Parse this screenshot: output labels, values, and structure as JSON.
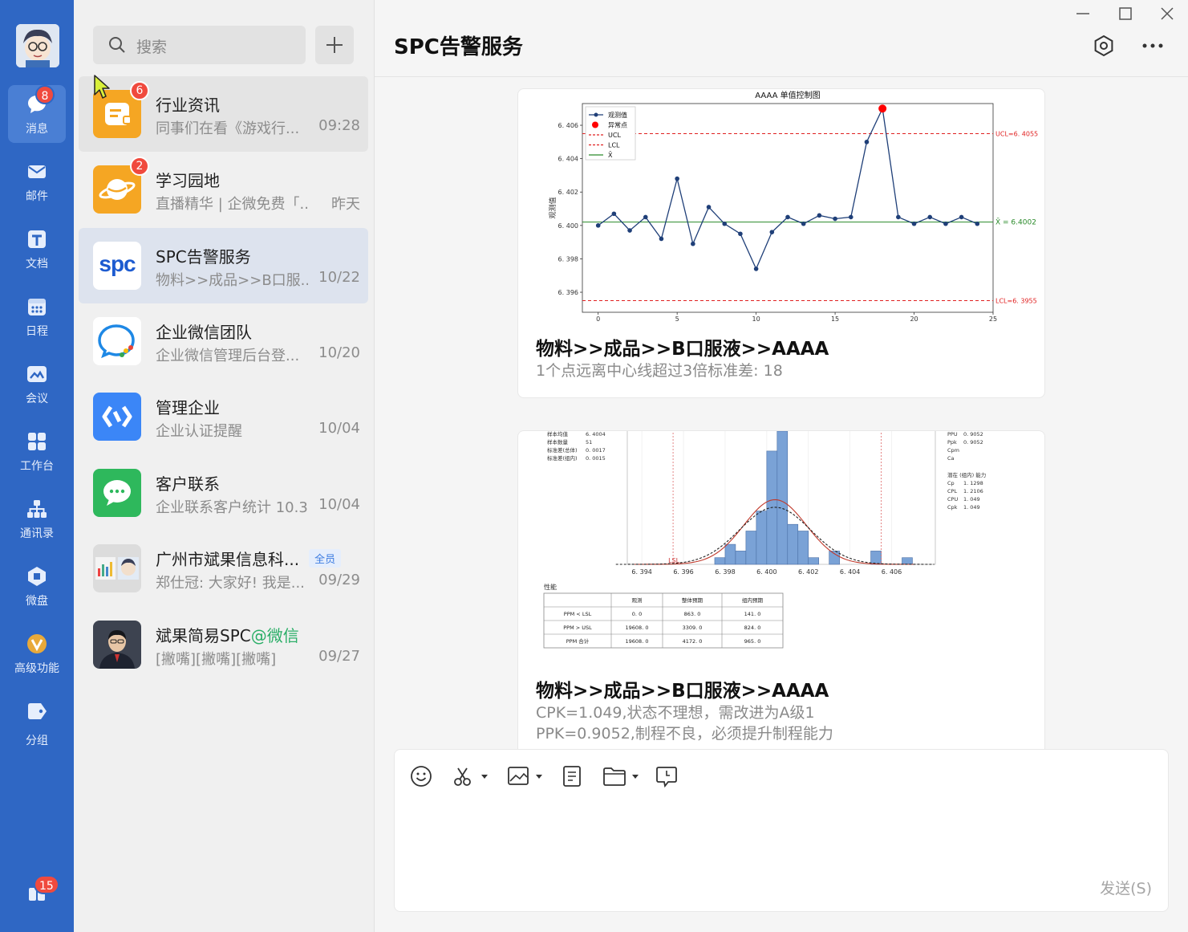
{
  "nav": {
    "items": [
      {
        "label": "消息",
        "badge": "8"
      },
      {
        "label": "邮件"
      },
      {
        "label": "文档"
      },
      {
        "label": "日程"
      },
      {
        "label": "会议"
      },
      {
        "label": "工作台"
      },
      {
        "label": "通讯录"
      },
      {
        "label": "微盘"
      },
      {
        "label": "高级功能"
      },
      {
        "label": "分组"
      }
    ],
    "bottom_badge": "15"
  },
  "search": {
    "placeholder": "搜索"
  },
  "conversations": [
    {
      "name": "行业资讯",
      "preview": "同事们在看《游戏行...",
      "time": "09:28",
      "badge": "6"
    },
    {
      "name": "学习园地",
      "preview": "直播精华 | 企微免费「...",
      "time": "昨天",
      "badge": "2"
    },
    {
      "name": "SPC告警服务",
      "preview": "物料>>成品>>B口服...",
      "time": "10/22",
      "avatar_text": "spc"
    },
    {
      "name": "企业微信团队",
      "preview": "企业微信管理后台登...",
      "time": "10/20"
    },
    {
      "name": "管理企业",
      "preview": "企业认证提醒",
      "time": "10/04"
    },
    {
      "name": "客户联系",
      "preview": "企业联系客户统计 10.3",
      "time": "10/04"
    },
    {
      "name": "广州市斌果信息科...",
      "tag": "全员",
      "preview": "郑仕冠: 大家好! 我是...",
      "time": "09/29"
    },
    {
      "name": "斌果简易SPC",
      "at": "@微信",
      "preview": "[撇嘴][撇嘴][撇嘴]",
      "time": "09/27"
    }
  ],
  "chat": {
    "title": "SPC告警服务",
    "messages": [
      {
        "title": "物料>>成品>>B口服液>>AAAA",
        "desc": "1个点远离中心线超过3倍标准差: 18"
      },
      {
        "title": "物料>>成品>>B口服液>>AAAA",
        "desc1": "CPK=1.049,状态不理想，需改进为A级1",
        "desc2": "PPK=0.9052,制程不良，必须提升制程能力"
      }
    ],
    "send_label": "发送(S)"
  },
  "chart_data": [
    {
      "type": "line",
      "title": "AAAA  单值控制图",
      "ylabel": "观测值",
      "xlim": [
        -1,
        25
      ],
      "ylim": [
        6.3948,
        6.4073
      ],
      "xticks": [
        0,
        5,
        10,
        15,
        20,
        25
      ],
      "yticks": [
        6.396,
        6.398,
        6.4,
        6.402,
        6.404,
        6.406
      ],
      "ytick_labels": [
        "6. 396",
        "6. 398",
        "6. 400",
        "6. 402",
        "6. 404",
        "6. 406"
      ],
      "legend": [
        "观测值",
        "异常点",
        "UCL",
        "LCL",
        "X̄"
      ],
      "legend_position": "top-left",
      "series": [
        {
          "name": "观测值",
          "color": "#1f3f78",
          "x": [
            0,
            1,
            2,
            3,
            4,
            5,
            6,
            7,
            8,
            9,
            10,
            11,
            12,
            13,
            14,
            15,
            16,
            17,
            18,
            19,
            20,
            21,
            22,
            23,
            24
          ],
          "values": [
            6.4,
            6.4007,
            6.3997,
            6.4005,
            6.3992,
            6.4028,
            6.3989,
            6.4011,
            6.4001,
            6.3995,
            6.3974,
            6.3996,
            6.4005,
            6.4001,
            6.4006,
            6.4004,
            6.4005,
            6.405,
            6.407,
            6.4005,
            6.4001,
            6.4005,
            6.4001,
            6.4005,
            6.4001
          ]
        },
        {
          "name": "异常点",
          "color": "#ff0000",
          "x": [
            18
          ],
          "values": [
            6.407
          ]
        }
      ],
      "ucl": 6.4055,
      "lcl": 6.3955,
      "center": 6.4002,
      "ucl_label": "UCL=6. 4055",
      "lcl_label": "LCL=6. 3955",
      "center_label": "X̄ = 6.4002"
    },
    {
      "type": "bar",
      "title": "",
      "x_ticks": [
        "6. 394",
        "6. 396",
        "6. 398",
        "6. 400",
        "6. 402",
        "6. 404",
        "6. 406"
      ],
      "x_tick_values": [
        6.394,
        6.396,
        6.398,
        6.4,
        6.402,
        6.404,
        6.406
      ],
      "xlim": [
        6.3933,
        6.4081
      ],
      "lsl": 6.3955,
      "usl": 6.4055,
      "lsl_label": "LSL",
      "bin_edges": [
        6.3975,
        6.398,
        6.3985,
        6.399,
        6.3995,
        6.4,
        6.4005,
        6.401,
        6.4015,
        6.402,
        6.4025,
        6.403,
        6.4035,
        6.404,
        6.4045,
        6.405,
        6.4055,
        6.406,
        6.4065,
        6.407
      ],
      "values": [
        1,
        3,
        2,
        5,
        8,
        17,
        20,
        6,
        5,
        1,
        0,
        2,
        0,
        0,
        0,
        2,
        0,
        0,
        1
      ],
      "ylim": [
        0,
        20
      ],
      "curves": [
        {
          "name": "组内",
          "color": "#c0392b",
          "sd": 0.0015
        },
        {
          "name": "整体",
          "color": "#222222",
          "sd": 0.0017,
          "dashed": true
        }
      ],
      "mean": 6.4004,
      "left_stats": [
        [
          "样本均值",
          "6. 4004"
        ],
        [
          "样本数量",
          "51"
        ],
        [
          "标准差(总体)",
          "0. 0017"
        ],
        [
          "标准差(组内)",
          "0. 0015"
        ]
      ],
      "right_stats_top": [
        [
          "PPU",
          "0. 9052"
        ],
        [
          "Ppk",
          "0. 9052"
        ],
        [
          "Cpm",
          ""
        ],
        [
          "Ca",
          ""
        ]
      ],
      "right_stats_title": "潜在 (组内) 能力",
      "right_stats": [
        [
          "Cp",
          "1. 1298"
        ],
        [
          "CPL",
          "1. 2106"
        ],
        [
          "CPU",
          "1. 049"
        ],
        [
          "Cpk",
          "1. 049"
        ]
      ],
      "perf_title": "性能",
      "table_headers": [
        "",
        "观测",
        "整体预期",
        "组内预期"
      ],
      "table_rows": [
        [
          "PPM < LSL",
          "0. 0",
          "863. 0",
          "141. 0"
        ],
        [
          "PPM > USL",
          "19608. 0",
          "3309. 0",
          "824. 0"
        ],
        [
          "PPM 合计",
          "19608. 0",
          "4172. 0",
          "965. 0"
        ]
      ]
    }
  ]
}
